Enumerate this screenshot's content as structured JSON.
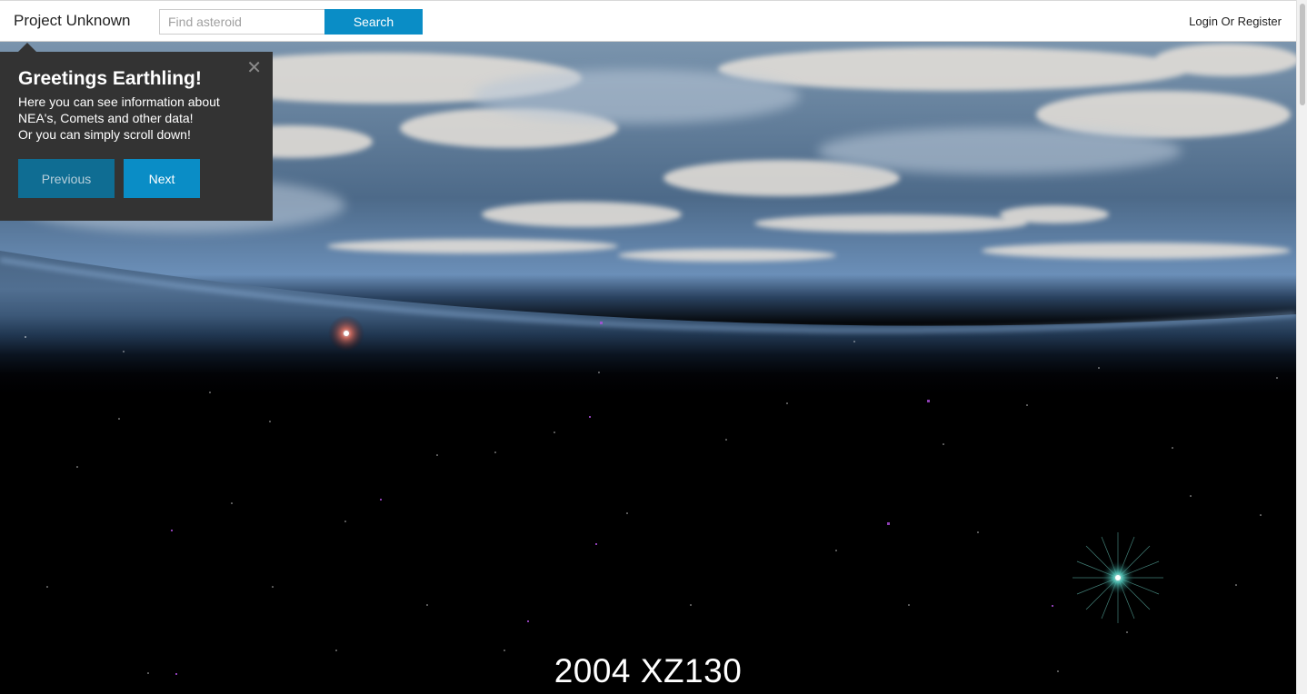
{
  "navbar": {
    "brand": "Project Unknown",
    "search_placeholder": "Find asteroid",
    "search_value": "",
    "search_button": "Search",
    "login_link": "Login Or Register"
  },
  "popover": {
    "title": "Greetings Earthling!",
    "body_lines": [
      "Here you can see information about",
      "NEA's, Comets and other data!",
      "Or you can simply scroll down!"
    ],
    "close_glyph": "✕",
    "prev_label": "Previous",
    "next_label": "Next"
  },
  "hero": {
    "asteroid_name": "2004 XZ130"
  },
  "colors": {
    "accent": "#0a8dc6",
    "accent_dark": "#0f6d93",
    "popover_bg": "#333333"
  },
  "icons": {
    "close": "close-icon"
  }
}
